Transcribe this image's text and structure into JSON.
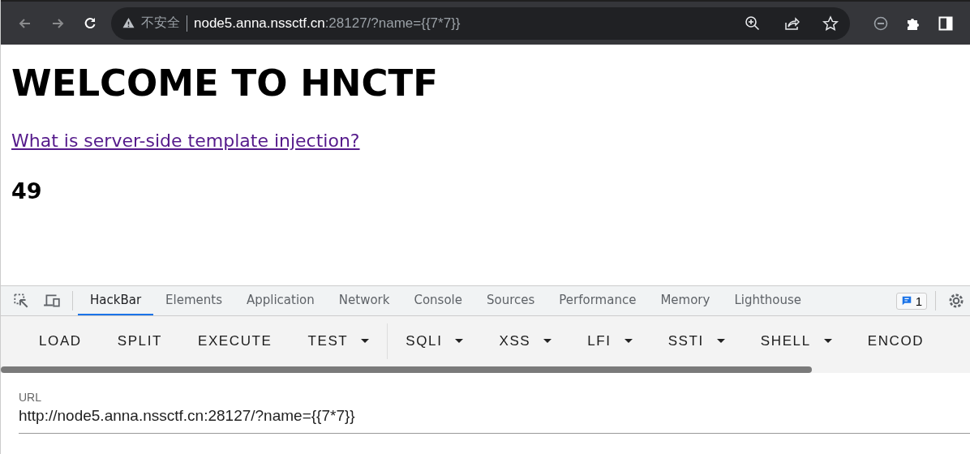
{
  "browser": {
    "address": {
      "security_label": "不安全",
      "host": "node5.anna.nssctf.cn",
      "rest": ":28127/?name={{7*7}}"
    }
  },
  "page": {
    "heading": "WELCOME TO HNCTF",
    "link": "What is server-side template injection?",
    "result": "49"
  },
  "devtools": {
    "tabs": [
      {
        "label": "HackBar",
        "selected": true
      },
      {
        "label": "Elements",
        "selected": false
      },
      {
        "label": "Application",
        "selected": false
      },
      {
        "label": "Network",
        "selected": false
      },
      {
        "label": "Console",
        "selected": false
      },
      {
        "label": "Sources",
        "selected": false
      },
      {
        "label": "Performance",
        "selected": false
      },
      {
        "label": "Memory",
        "selected": false
      },
      {
        "label": "Lighthouse",
        "selected": false
      }
    ],
    "issues_badge": "1"
  },
  "hackbar": {
    "buttons": [
      {
        "label": "LOAD",
        "dropdown": false
      },
      {
        "label": "SPLIT",
        "dropdown": false
      },
      {
        "label": "EXECUTE",
        "dropdown": false
      },
      {
        "label": "TEST",
        "dropdown": true
      },
      {
        "label": "SQLI",
        "dropdown": true,
        "separator_before": true
      },
      {
        "label": "XSS",
        "dropdown": true
      },
      {
        "label": "LFI",
        "dropdown": true
      },
      {
        "label": "SSTI",
        "dropdown": true
      },
      {
        "label": "SHELL",
        "dropdown": true
      },
      {
        "label": "ENCOD",
        "dropdown": false
      }
    ],
    "url_field": {
      "label": "URL",
      "value": "http://node5.anna.nssctf.cn:28127/?name={{7*7}}"
    }
  }
}
